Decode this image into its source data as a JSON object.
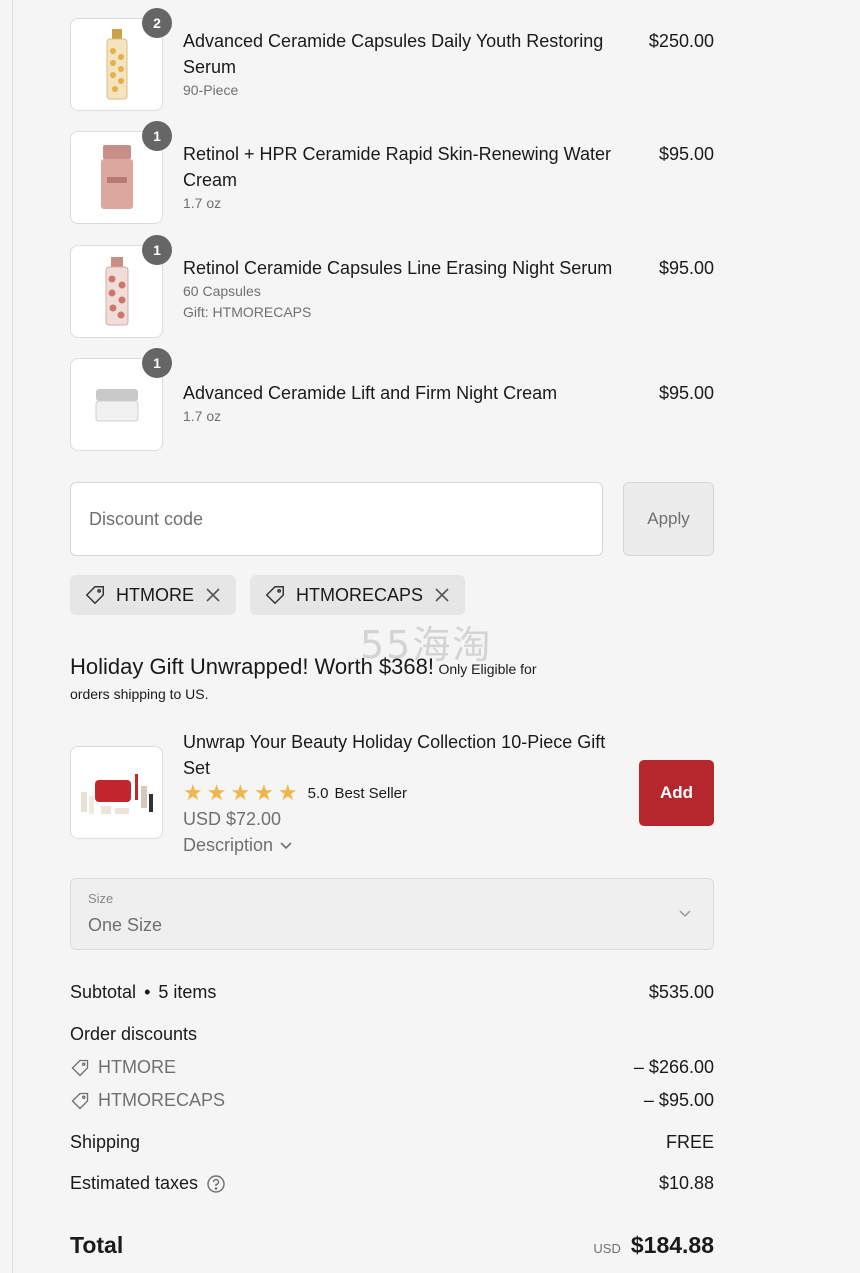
{
  "line_items": [
    {
      "quantity": "2",
      "name": "Advanced Ceramide Capsules Daily Youth Restoring Serum",
      "details": [
        "90-Piece"
      ],
      "price": "$250.00",
      "thumb_icon": "gold-capsule-bottle-icon"
    },
    {
      "quantity": "1",
      "name": "Retinol + HPR Ceramide Rapid Skin-Renewing Water Cream",
      "details": [
        "1.7 oz"
      ],
      "price": "$95.00",
      "thumb_icon": "pink-jar-icon"
    },
    {
      "quantity": "1",
      "name": "Retinol Ceramide Capsules Line Erasing Night Serum",
      "details": [
        "60 Capsules",
        "Gift: HTMORECAPS"
      ],
      "price": "$95.00",
      "thumb_icon": "pink-capsule-bottle-icon"
    },
    {
      "quantity": "1",
      "name": "Advanced Ceramide Lift and Firm Night Cream",
      "details": [
        "1.7 oz"
      ],
      "price": "$95.00",
      "thumb_icon": "white-cream-jar-icon"
    }
  ],
  "discount": {
    "placeholder": "Discount code",
    "apply_label": "Apply",
    "applied_codes": [
      "HTMORE",
      "HTMORECAPS"
    ]
  },
  "watermark": "55海淘",
  "promo": {
    "title": "Holiday Gift Unwrapped! Worth $368!",
    "note_line1": "Only Eligible for",
    "note_line2": "orders shipping to US.",
    "product": {
      "name": "Unwrap Your Beauty Holiday Collection 10-Piece Gift Set",
      "rating": "5.0",
      "rating_stars": 5,
      "badge": "Best Seller",
      "price": "USD $72.00",
      "description_label": "Description",
      "add_label": "Add",
      "thumb_icon": "gift-set-icon"
    },
    "size": {
      "label": "Size",
      "value": "One Size"
    }
  },
  "summary": {
    "subtotal_label": "Subtotal",
    "subtotal_items": "5 items",
    "subtotal_value": "$535.00",
    "order_discounts_label": "Order discounts",
    "discounts": [
      {
        "code": "HTMORE",
        "amount": "– $266.00"
      },
      {
        "code": "HTMORECAPS",
        "amount": "– $95.00"
      }
    ],
    "shipping_label": "Shipping",
    "shipping_value": "FREE",
    "taxes_label": "Estimated taxes",
    "taxes_value": "$10.88",
    "total_label": "Total",
    "total_currency": "USD",
    "total_value": "$184.88"
  },
  "colors": {
    "add_button": "#b3272d",
    "star": "#f0b64b",
    "badge": "#666666"
  }
}
